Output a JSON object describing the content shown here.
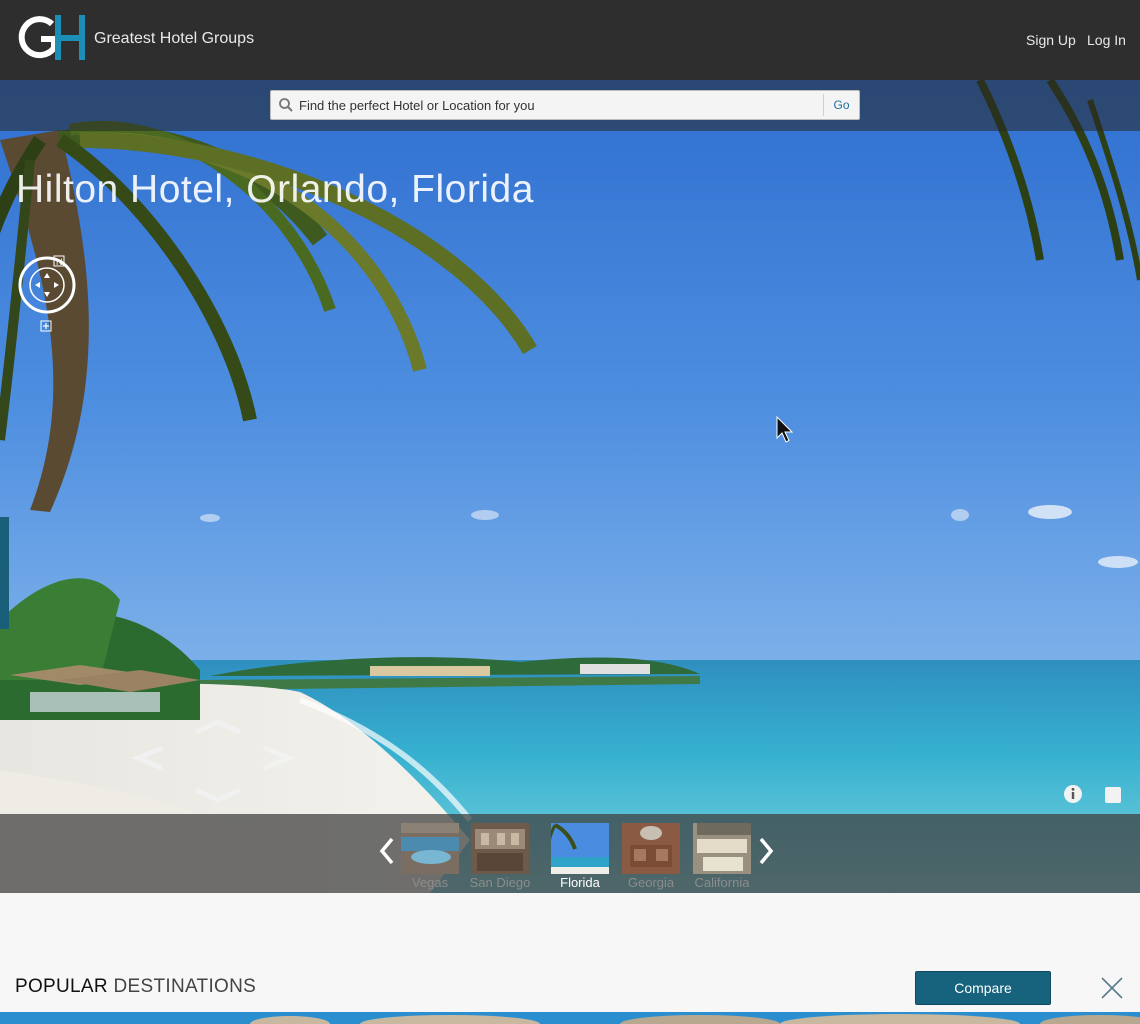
{
  "brand": {
    "monogram": "GH",
    "name": "Greatest Hotel Groups"
  },
  "auth": {
    "signup_label": "Sign Up",
    "login_label": "Log In"
  },
  "search": {
    "placeholder": "Find the perfect Hotel or Location for you",
    "go_label": "Go"
  },
  "hero": {
    "title": "Hilton Hotel, Orlando, Florida",
    "compass_north": "N"
  },
  "thumbnails": [
    {
      "label": "Vegas",
      "active": false
    },
    {
      "label": "San Diego",
      "active": false
    },
    {
      "label": "Florida",
      "active": true
    },
    {
      "label": "Georgia",
      "active": false
    },
    {
      "label": "California",
      "active": false
    }
  ],
  "popular": {
    "heading_strong": "POPULAR",
    "heading_light": "DESTINATIONS",
    "compare_label": "Compare"
  },
  "colors": {
    "accent": "#17627d",
    "header_bg": "#2e2e2e",
    "logo_blue": "#1b8fb5"
  },
  "icons": [
    "search-icon",
    "compass-icon",
    "zoom-in-icon",
    "info-icon",
    "fullscreen-icon",
    "chevron-left-icon",
    "chevron-right-icon",
    "close-icon",
    "cursor-icon"
  ]
}
